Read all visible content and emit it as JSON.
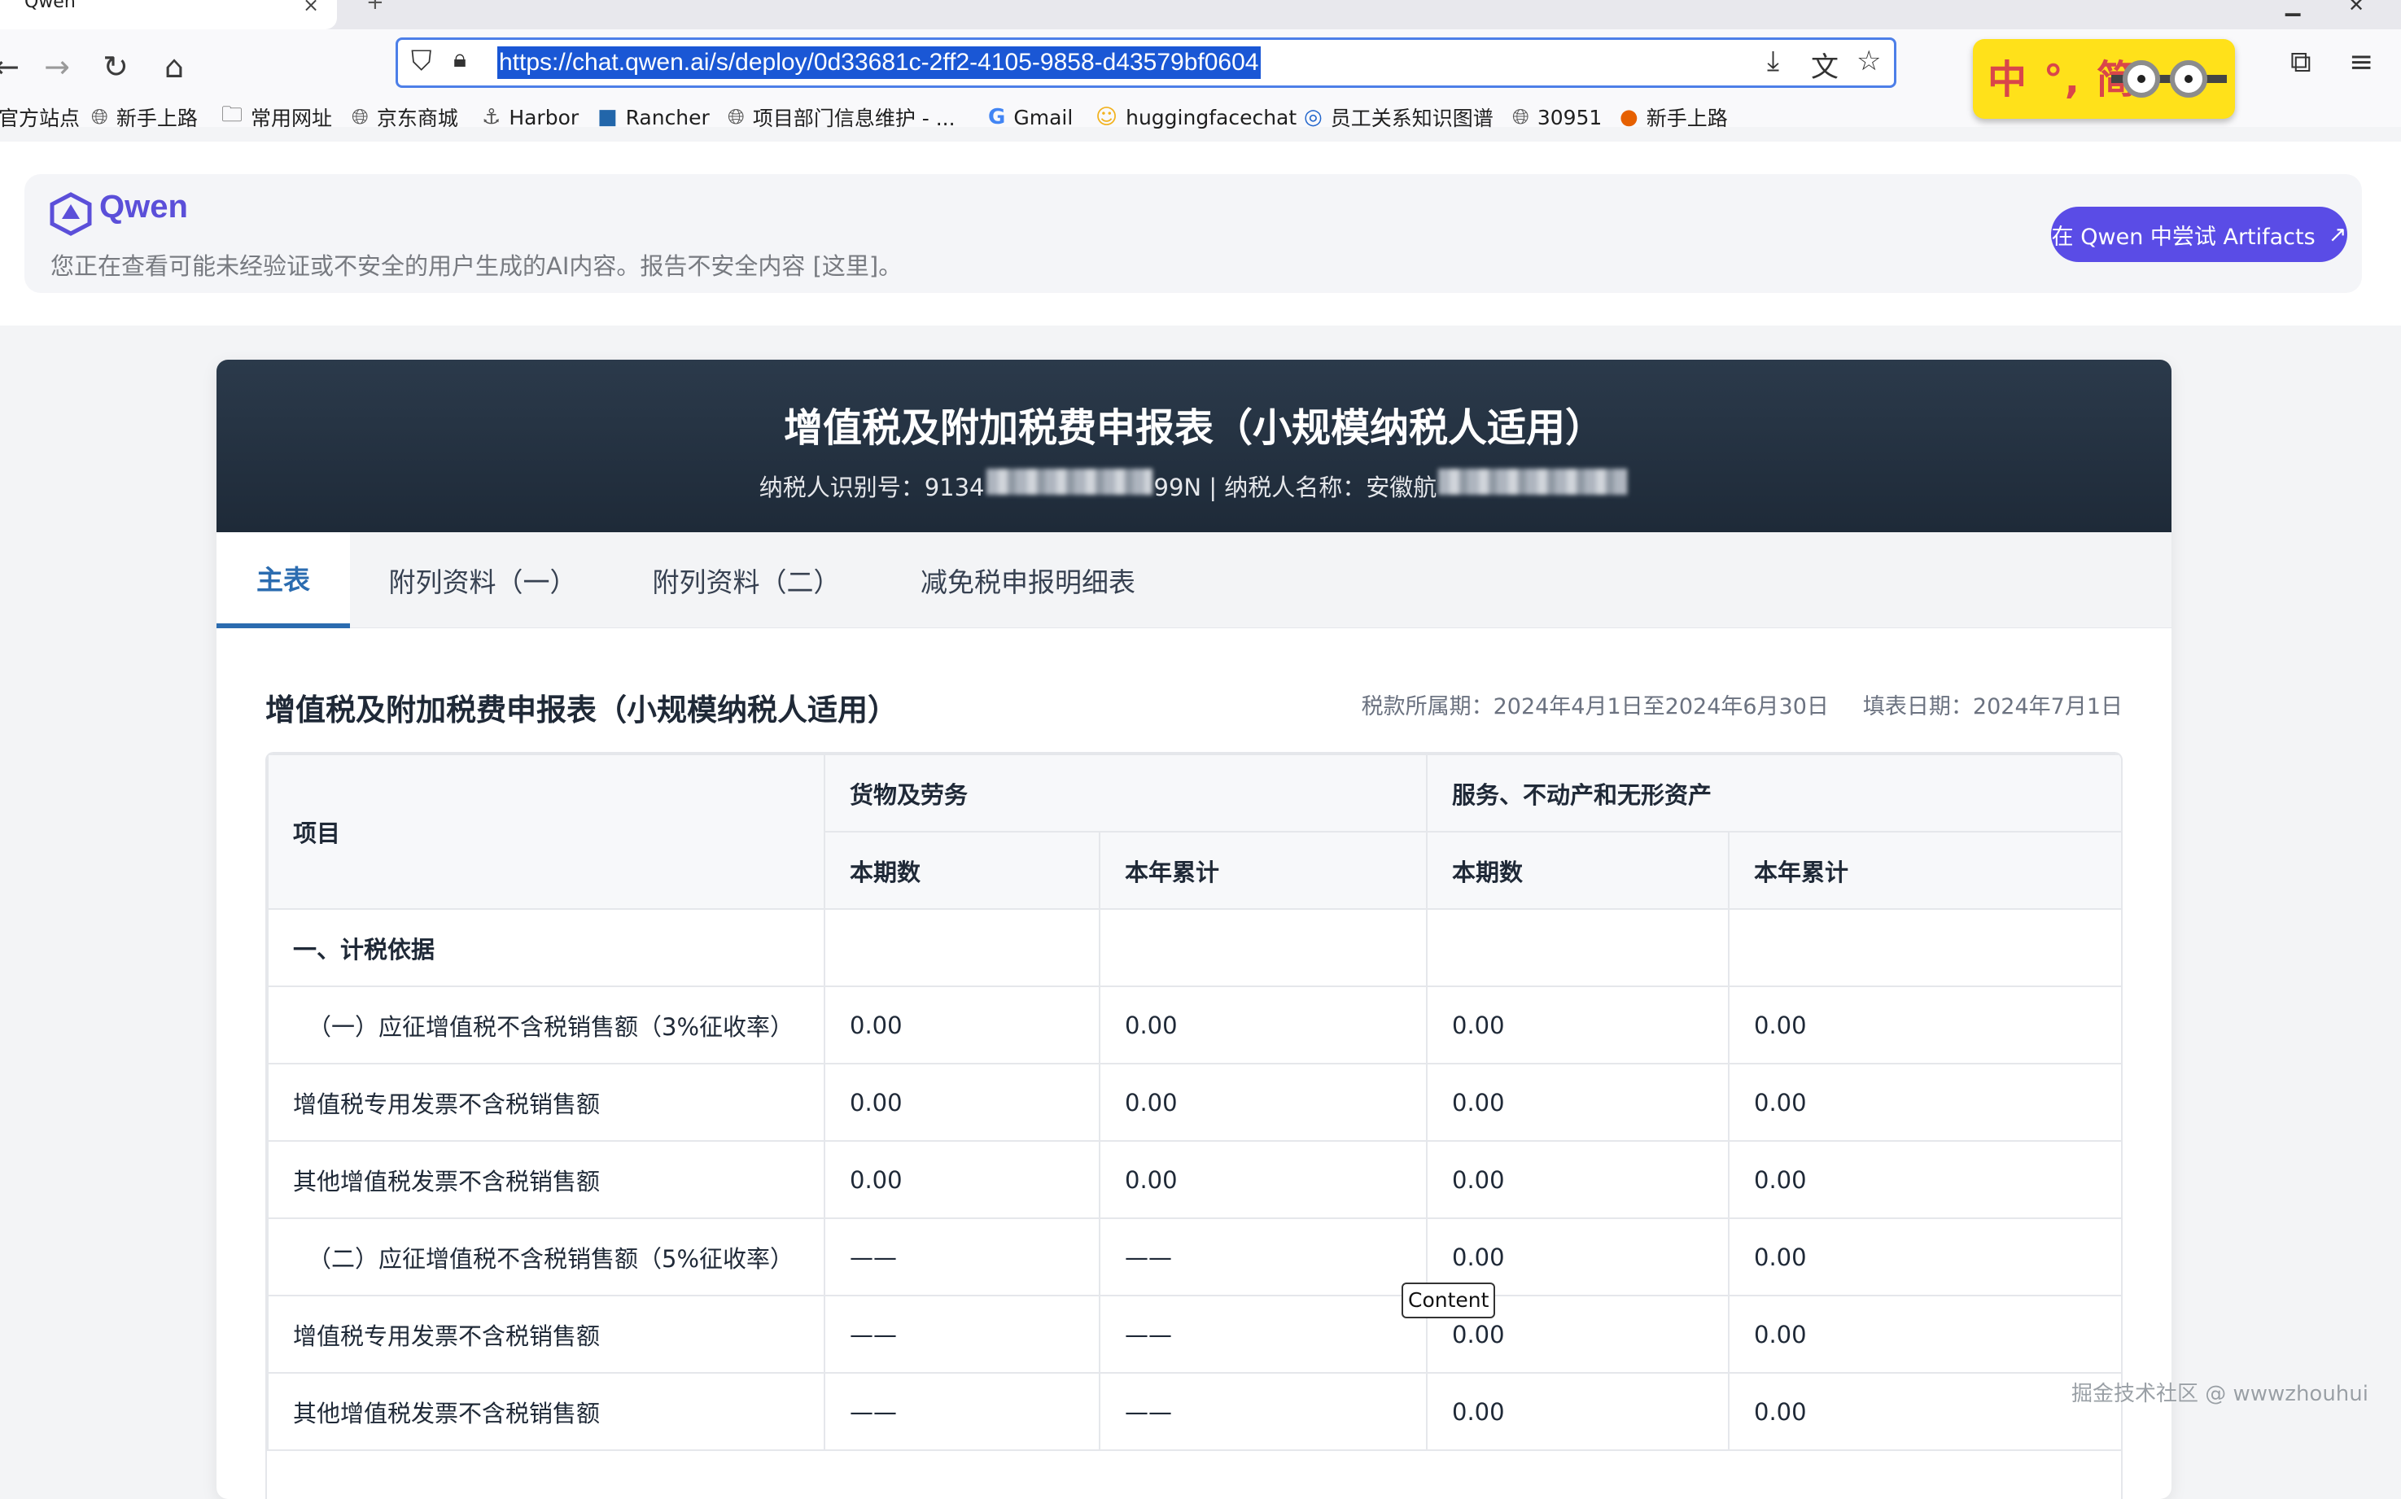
{
  "browser": {
    "tab_title": "Qwen",
    "tab_close": "×",
    "new_tab": "+",
    "url": "https://chat.qwen.ai/s/deploy/0d33681c-2ff2-4105-9858-d43579bf0604",
    "extension_text": "中 °, 简",
    "bookmarks": [
      {
        "label": "官方站点",
        "icon": "none"
      },
      {
        "label": "新手上路",
        "icon": "globe-icon"
      },
      {
        "label": "常用网址",
        "icon": "folder-icon"
      },
      {
        "label": "京东商城",
        "icon": "globe-icon"
      },
      {
        "label": "Harbor",
        "icon": "harbor-icon"
      },
      {
        "label": "Rancher",
        "icon": "rancher-icon"
      },
      {
        "label": "项目部门信息维护 - ...",
        "icon": "globe-icon"
      },
      {
        "label": "Gmail",
        "icon": "google-icon"
      },
      {
        "label": "huggingfacechat",
        "icon": "huggingface-icon"
      },
      {
        "label": "员工关系知识图谱",
        "icon": "globe-icon"
      },
      {
        "label": "30951",
        "icon": "globe-icon"
      },
      {
        "label": "新手上路",
        "icon": "firefox-icon"
      }
    ]
  },
  "banner": {
    "brand": "Qwen",
    "note": "您正在查看可能未经验证或不安全的用户生成的AI内容。报告不安全内容 [这里]。",
    "button_label": "在 Qwen 中尝试 Artifacts",
    "button_color": "#5a4ce6"
  },
  "form": {
    "header_title": "增值税及附加税费申报表（小规模纳税人适用）",
    "taxpayer_id_label": "纳税人识别号：9134",
    "taxpayer_id_tail": "99N | 纳税人名称：安徽航",
    "tabs": [
      "主表",
      "附列资料（一）",
      "附列资料（二）",
      "减免税申报明细表"
    ],
    "section_title": "增值税及附加税费申报表（小规模纳税人适用）",
    "tax_period": "税款所属期：2024年4月1日至2024年6月30日",
    "fill_date": "填表日期：2024年7月1日",
    "table": {
      "col_item": "项目",
      "group_goods": "货物及劳务",
      "group_services": "服务、不动产和无形资产",
      "sub_cols": [
        "本期数",
        "本年累计",
        "本期数",
        "本年累计"
      ],
      "rows": [
        {
          "label": "一、计税依据",
          "values": [
            "",
            "",
            "",
            ""
          ],
          "section": true,
          "indent": false
        },
        {
          "label": "（一）应征增值税不含税销售额（3%征收率）",
          "values": [
            "0.00",
            "0.00",
            "0.00",
            "0.00"
          ],
          "section": false,
          "indent": true
        },
        {
          "label": "增值税专用发票不含税销售额",
          "values": [
            "0.00",
            "0.00",
            "0.00",
            "0.00"
          ],
          "section": false,
          "indent": false
        },
        {
          "label": "其他增值税发票不含税销售额",
          "values": [
            "0.00",
            "0.00",
            "0.00",
            "0.00"
          ],
          "section": false,
          "indent": false
        },
        {
          "label": "（二）应征增值税不含税销售额（5%征收率）",
          "values": [
            "——",
            "——",
            "0.00",
            "0.00"
          ],
          "section": false,
          "indent": true
        },
        {
          "label": "增值税专用发票不含税销售额",
          "values": [
            "——",
            "——",
            "0.00",
            "0.00"
          ],
          "section": false,
          "indent": false
        },
        {
          "label": "其他增值税发票不含税销售额",
          "values": [
            "——",
            "——",
            "0.00",
            "0.00"
          ],
          "section": false,
          "indent": false
        }
      ]
    }
  },
  "tooltip": "Content",
  "watermark": "掘金技术社区 @ wwwzhouhui"
}
